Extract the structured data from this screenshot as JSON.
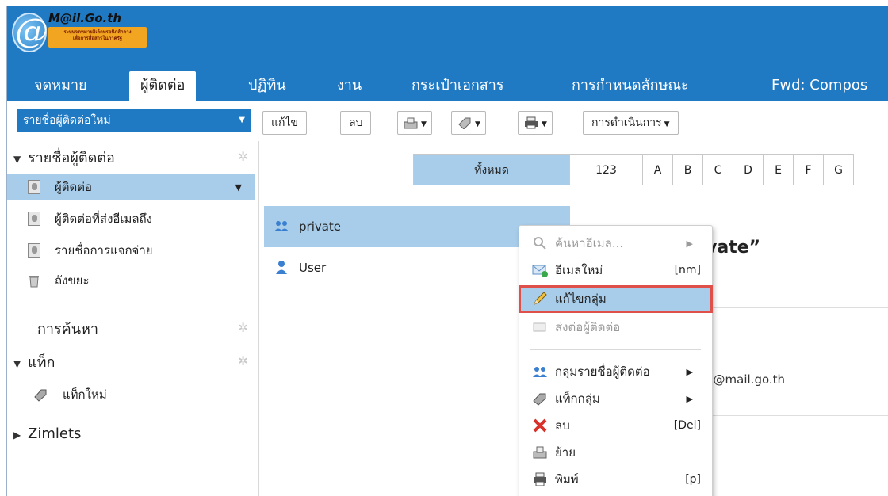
{
  "logo": {
    "title": "M@il.Go.th",
    "subtitle_line1": "ระบบจดหมายอิเล็กทรอนิกส์กลาง",
    "subtitle_line2": "เพื่อการสื่อสารในภาครัฐ"
  },
  "tabs": [
    {
      "label": "จดหมาย"
    },
    {
      "label": "ผู้ติดต่อ"
    },
    {
      "label": "ปฏิทิน"
    },
    {
      "label": "งาน"
    },
    {
      "label": "กระเป๋าเอกสาร"
    },
    {
      "label": "การกำหนดลักษณะ"
    },
    {
      "label": "Fwd: Compos"
    }
  ],
  "toolbar": {
    "new_contact_list": "รายชื่อผู้ติดต่อใหม่",
    "edit": "แก้ไข",
    "delete": "ลบ",
    "actions": "การดำเนินการ"
  },
  "sidebar": {
    "contacts_header": "รายชื่อผู้ติดต่อ",
    "items": [
      {
        "label": "ผู้ติดต่อ"
      },
      {
        "label": "ผู้ติดต่อที่ส่งอีเมลถึง"
      },
      {
        "label": "รายชื่อการแจกจ่าย"
      },
      {
        "label": "ถังขยะ"
      }
    ],
    "search_header": "การค้นหา",
    "tags_header": "แท็ก",
    "new_tag": "แท็กใหม่",
    "zimlets_header": "Zimlets"
  },
  "alphabet": [
    "ทั้งหมด",
    "123",
    "A",
    "B",
    "C",
    "D",
    "E",
    "F",
    "G"
  ],
  "contacts": [
    {
      "label": "private"
    },
    {
      "label": "User"
    }
  ],
  "detail": {
    "title_fragment": "vate”",
    "email_fragment": "1@mail.go.th"
  },
  "context_menu": {
    "items": [
      {
        "label": "ค้นหาอีเมล...",
        "shortcut": "",
        "state": "disabled",
        "icon": "search-icon"
      },
      {
        "label": "อีเมลใหม่",
        "shortcut": "[nm]",
        "state": "normal",
        "icon": "new-email-icon"
      },
      {
        "label": "แก้ไขกลุ่ม",
        "shortcut": "",
        "state": "highlighted",
        "icon": "pencil-icon"
      },
      {
        "label": "ส่งต่อผู้ติดต่อ",
        "shortcut": "",
        "state": "disabled",
        "icon": "forward-contact-icon"
      },
      {
        "label": "กลุ่มรายชื่อผู้ติดต่อ",
        "shortcut": "",
        "state": "normal",
        "icon": "group-icon"
      },
      {
        "label": "แท็กกลุ่ม",
        "shortcut": "",
        "state": "normal",
        "icon": "tag-icon"
      },
      {
        "label": "ลบ",
        "shortcut": "[Del]",
        "state": "normal",
        "icon": "delete-icon"
      },
      {
        "label": "ย้าย",
        "shortcut": "",
        "state": "normal",
        "icon": "move-icon"
      },
      {
        "label": "พิมพ์",
        "shortcut": "[p]",
        "state": "normal",
        "icon": "print-icon"
      }
    ]
  },
  "colors": {
    "header_blue": "#1f79c3",
    "selection_blue": "#a8cdea",
    "highlight_red": "#e0504a"
  }
}
